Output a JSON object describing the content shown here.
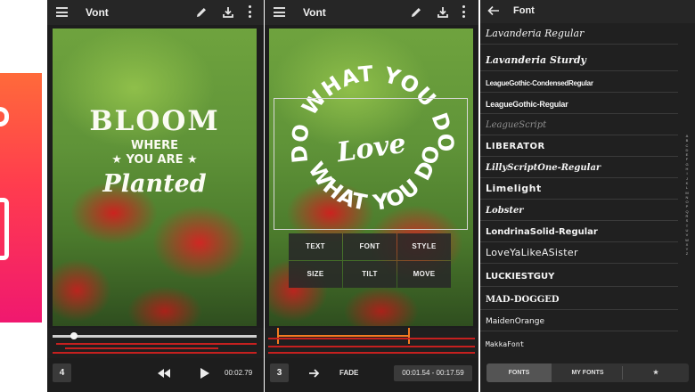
{
  "app": {
    "title": "Vont"
  },
  "screen1": {
    "poster": {
      "line1": "BLOOM",
      "line2": "WHERE",
      "line3": "★ YOU ARE ★",
      "line4": "Planted"
    },
    "clip_number": "4",
    "time": "00:02.79"
  },
  "screen2": {
    "circle_outer": "DO WHAT YOU DO",
    "circle_inner": "Love",
    "circle_lower": "WHAT YOU DO",
    "ops": [
      {
        "label": "TEXT"
      },
      {
        "label": "FONT"
      },
      {
        "label": "STYLE"
      },
      {
        "label": "SIZE"
      },
      {
        "label": "TILT"
      },
      {
        "label": "MOVE"
      }
    ],
    "clip_number": "3",
    "transition": "FADE",
    "time_range": "00:01.54 - 00:17.59"
  },
  "screen3": {
    "title": "Font",
    "fonts": [
      "Lavanderia Regular",
      "Lavanderia Sturdy",
      "LeagueGothic-CondensedRegular",
      "LeagueGothic-Regular",
      "LeagueScript",
      "LIBERATOR",
      "LillyScriptOne-Regular",
      "Limelight",
      "Lobster",
      "LondrinaSolid-Regular",
      "LoveYaLikeASister",
      "LUCKIESTGUY",
      "MAD-DOGGED",
      "MaidenOrange",
      "MakkaFont"
    ],
    "alpha_index": [
      "A",
      "B",
      "C",
      "D",
      "E",
      "F",
      "G",
      "H",
      "I",
      "J",
      "K",
      "L",
      "M",
      "N",
      "O",
      "P",
      "Q",
      "R",
      "S",
      "T",
      "U",
      "V",
      "W",
      "X",
      "Y",
      "Z"
    ],
    "tabs": [
      "FONTS",
      "MY FONTS",
      "★"
    ]
  },
  "colors": {
    "accent_red": "#c6201f",
    "accent_orange": "#f27b22",
    "promo_gradient_top": "#ff6a3a",
    "promo_gradient_bottom": "#f0186f"
  },
  "icons": [
    "menu-icon",
    "pencil-icon",
    "download-icon",
    "more-vert-icon",
    "rewind-icon",
    "play-icon",
    "arrow-right-icon",
    "arrow-back-icon"
  ]
}
